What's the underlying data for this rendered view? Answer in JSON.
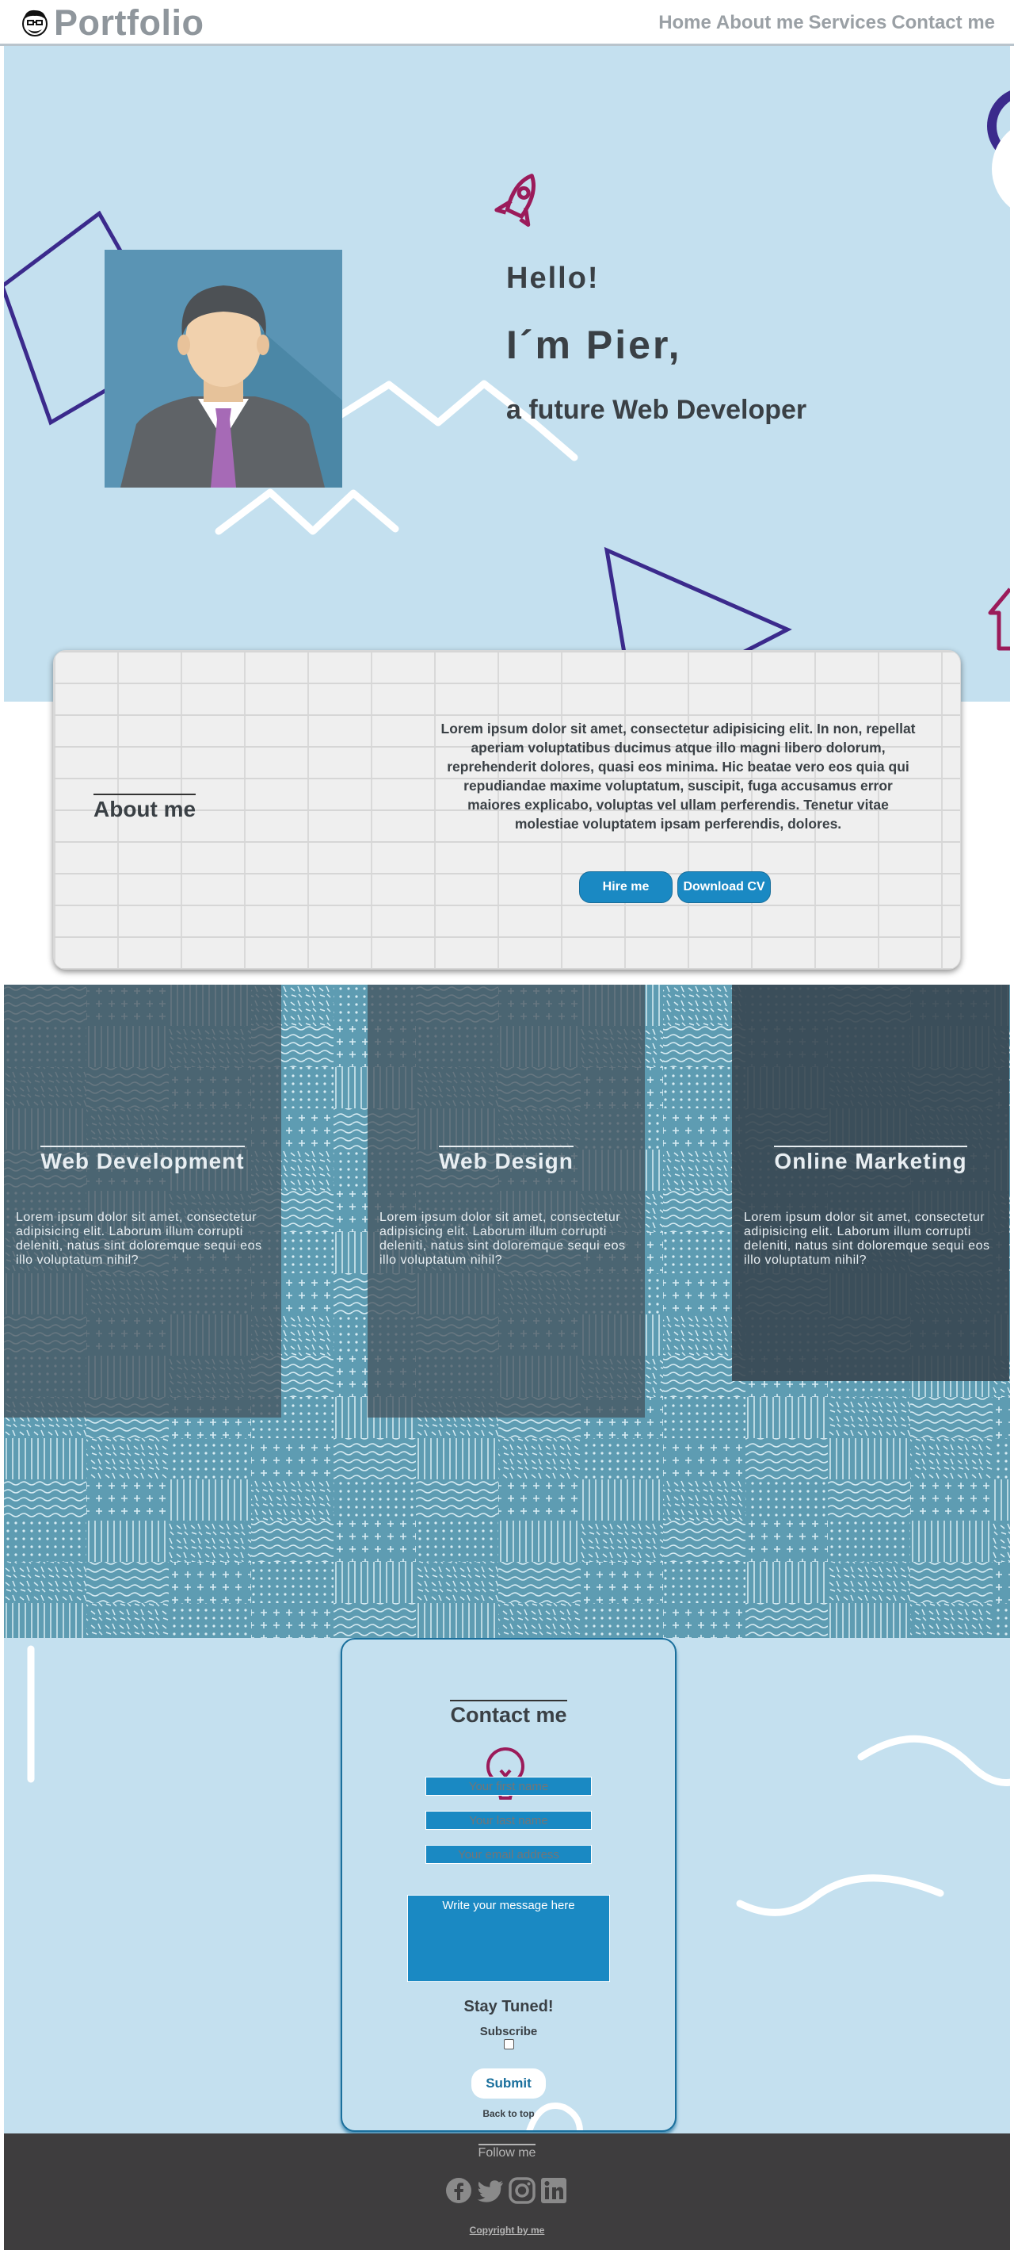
{
  "header": {
    "logo_text": "Portfolio",
    "nav": [
      "Home",
      "About me",
      "Services",
      "Contact me"
    ]
  },
  "hero": {
    "hello": "Hello!",
    "name": "I´m Pier,",
    "role": "a future Web Developer"
  },
  "about": {
    "title": "About me",
    "text": "Lorem ipsum dolor sit amet, consectetur adipisicing elit. In non, repellat aperiam voluptatibus ducimus atque illo magni libero dolorum, reprehenderit dolores, quasi eos minima. Hic beatae vero eos quia qui repudiandae maxime voluptatum, suscipit, fuga accusamus error maiores explicabo, voluptas vel ullam perferendis. Tenetur vitae molestiae voluptatem ipsam perferendis, dolores.",
    "hire_label": "Hire me",
    "cv_label": "Download CV"
  },
  "services": [
    {
      "title": "Web Development",
      "text": "Lorem ipsum dolor sit amet, consectetur adipisicing elit. Laborum illum corrupti deleniti, natus sint doloremque sequi eos illo voluptatum nihil?"
    },
    {
      "title": "Web Design",
      "text": "Lorem ipsum dolor sit amet, consectetur adipisicing elit. Laborum illum corrupti deleniti, natus sint doloremque sequi eos illo voluptatum nihil?"
    },
    {
      "title": "Online Marketing",
      "text": "Lorem ipsum dolor sit amet, consectetur adipisicing elit. Laborum illum corrupti deleniti, natus sint doloremque sequi eos illo voluptatum nihil?"
    }
  ],
  "contact": {
    "title": "Contact me",
    "first_name_placeholder": "Your first name",
    "last_name_placeholder": "Your last name",
    "email_placeholder": "Your email address",
    "message_placeholder": "Write your message here",
    "stay_tuned": "Stay Tuned!",
    "subscribe_label": "Subscribe",
    "submit_label": "Submit",
    "back_to_top": "Back to top"
  },
  "footer": {
    "follow": "Follow me",
    "socials": [
      "facebook-icon",
      "twitter-icon",
      "instagram-icon",
      "linkedin-icon"
    ],
    "copyright": "Copyright by me"
  },
  "colors": {
    "hero_bg": "#c4e0ef",
    "accent_blue": "#1a89c3",
    "purple": "#3b2a8c",
    "magenta": "#9b1b5a",
    "footer_bg": "#3e3d3e"
  }
}
